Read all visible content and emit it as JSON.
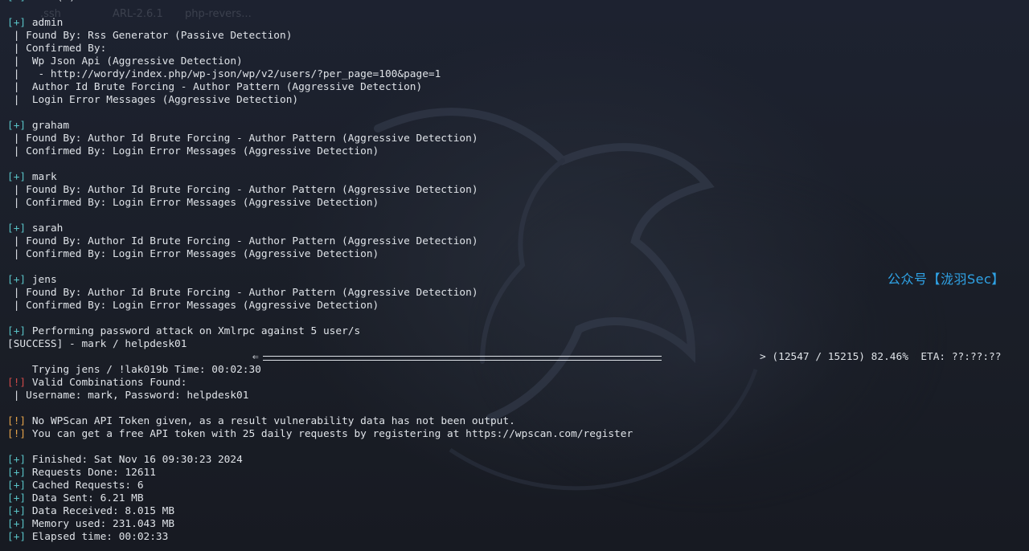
{
  "watermark": "公众号【泷羽Sec】",
  "desktop_ghost": {
    "item1": "ARL-2.6.1",
    "item2": "php-revers..."
  },
  "header": "[+] User(s) Identified:",
  "users": [
    {
      "tag": "[+]",
      "name": "admin",
      "lines": [
        " | Found By: Rss Generator (Passive Detection)",
        " | Confirmed By:",
        " |  Wp Json Api (Aggressive Detection)",
        " |   - http://wordy/index.php/wp-json/wp/v2/users/?per_page=100&page=1",
        " |  Author Id Brute Forcing - Author Pattern (Aggressive Detection)",
        " |  Login Error Messages (Aggressive Detection)"
      ]
    },
    {
      "tag": "[+]",
      "name": "graham",
      "lines": [
        " | Found By: Author Id Brute Forcing - Author Pattern (Aggressive Detection)",
        " | Confirmed By: Login Error Messages (Aggressive Detection)"
      ]
    },
    {
      "tag": "[+]",
      "name": "mark",
      "lines": [
        " | Found By: Author Id Brute Forcing - Author Pattern (Aggressive Detection)",
        " | Confirmed By: Login Error Messages (Aggressive Detection)"
      ]
    },
    {
      "tag": "[+]",
      "name": "sarah",
      "lines": [
        " | Found By: Author Id Brute Forcing - Author Pattern (Aggressive Detection)",
        " | Confirmed By: Login Error Messages (Aggressive Detection)"
      ]
    },
    {
      "tag": "[+]",
      "name": "jens",
      "lines": [
        " | Found By: Author Id Brute Forcing - Author Pattern (Aggressive Detection)",
        " | Confirmed By: Login Error Messages (Aggressive Detection)"
      ]
    }
  ],
  "attack": {
    "tag": "[+]",
    "text": "Performing password attack on Xmlrpc against 5 user/s",
    "success": "[SUCCESS] - mark / helpdesk01",
    "trying": "Trying jens / !lak019b Time: 00:02:30",
    "progress_tail": "> (12547 / 15215) 82.46%  ETA: ??:??:??",
    "progress_fraction": 0.8246
  },
  "valid": {
    "tag": "[!]",
    "title": "Valid Combinations Found:",
    "line": " | Username: mark, Password: helpdesk01"
  },
  "notes": [
    {
      "tag": "[!]",
      "text": "No WPScan API Token given, as a result vulnerability data has not been output."
    },
    {
      "tag": "[!]",
      "text": "You can get a free API token with 25 daily requests by registering at https://wpscan.com/register"
    }
  ],
  "summary": [
    {
      "tag": "[+]",
      "text": "Finished: Sat Nov 16 09:30:23 2024"
    },
    {
      "tag": "[+]",
      "text": "Requests Done: 12611"
    },
    {
      "tag": "[+]",
      "text": "Cached Requests: 6"
    },
    {
      "tag": "[+]",
      "text": "Data Sent: 6.21 MB"
    },
    {
      "tag": "[+]",
      "text": "Data Received: 8.015 MB"
    },
    {
      "tag": "[+]",
      "text": "Memory used: 231.043 MB"
    },
    {
      "tag": "[+]",
      "text": "Elapsed time: 00:02:33"
    }
  ],
  "colors": {
    "plus": "#59c2c6",
    "warn": "#e5a34a",
    "err": "#d04a4a",
    "text": "#dfe3e8",
    "watermark": "#2fa3e6"
  }
}
